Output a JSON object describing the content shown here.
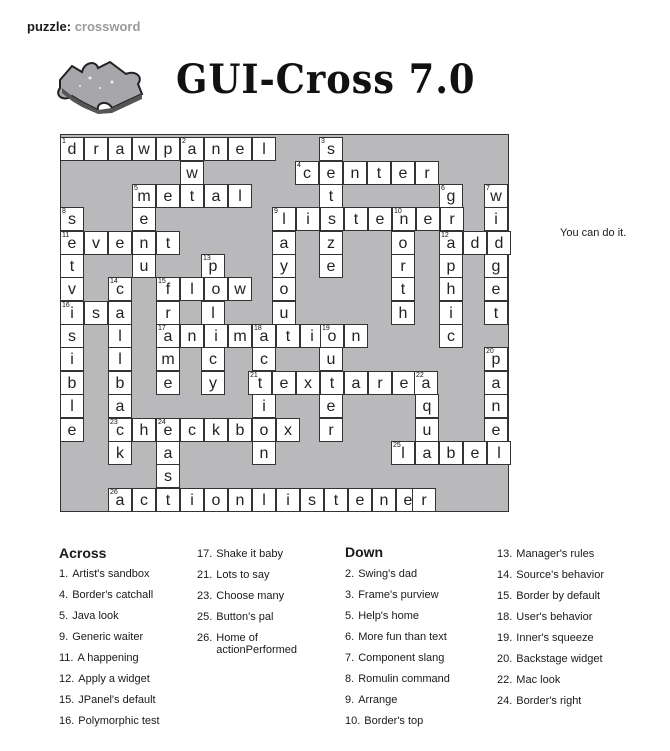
{
  "header": {
    "label": "puzzle:",
    "value": "crossword"
  },
  "title": "GUI-Cross 7.0",
  "note": "You can do it.",
  "grid": {
    "cells": [
      [
        "n0",
        60,
        137,
        "1",
        "d"
      ],
      [
        "n0",
        84,
        137,
        "",
        "r"
      ],
      [
        "n0",
        108,
        137,
        "",
        "a"
      ],
      [
        "n0",
        132,
        137,
        "",
        "w"
      ],
      [
        "n0",
        156,
        137,
        "",
        "p"
      ],
      [
        "n0",
        180,
        137,
        "2",
        "a"
      ],
      [
        "n0",
        204,
        137,
        "",
        "n"
      ],
      [
        "n0",
        228,
        137,
        "",
        "e"
      ],
      [
        "n0",
        252,
        137,
        "",
        "l"
      ],
      [
        "n0",
        319,
        137,
        "3",
        "s"
      ],
      [
        "n0",
        180,
        161,
        "",
        "w"
      ],
      [
        "n0",
        295,
        161,
        "4",
        "c"
      ],
      [
        "n0",
        319,
        161,
        "",
        "e"
      ],
      [
        "n0",
        343,
        161,
        "",
        "n"
      ],
      [
        "n0",
        367,
        161,
        "",
        "t"
      ],
      [
        "n0",
        391,
        161,
        "",
        "e"
      ],
      [
        "n0",
        415,
        161,
        "",
        "r"
      ],
      [
        "n0",
        132,
        184,
        "5",
        "m"
      ],
      [
        "n0",
        156,
        184,
        "",
        "e"
      ],
      [
        "n0",
        180,
        184,
        "",
        "t"
      ],
      [
        "n0",
        204,
        184,
        "",
        "a"
      ],
      [
        "n0",
        228,
        184,
        "",
        "l"
      ],
      [
        "n0",
        319,
        184,
        "",
        "t"
      ],
      [
        "n0",
        439,
        184,
        "6",
        "g"
      ],
      [
        "n0",
        484,
        184,
        "7",
        "w"
      ],
      [
        "n0",
        60,
        207,
        "8",
        "s"
      ],
      [
        "n0",
        132,
        207,
        "",
        "e"
      ],
      [
        "n0",
        272,
        207,
        "9",
        "l"
      ],
      [
        "n0",
        296,
        207,
        "",
        "i"
      ],
      [
        "n0",
        320,
        207,
        "",
        "s"
      ],
      [
        "n0",
        344,
        207,
        "",
        "t"
      ],
      [
        "n0",
        368,
        207,
        "",
        "e"
      ],
      [
        "n0",
        392,
        207,
        "10",
        "n"
      ],
      [
        "n0",
        416,
        207,
        "",
        "e"
      ],
      [
        "n0",
        440,
        207,
        "",
        "r"
      ],
      [
        "n0",
        484,
        207,
        "",
        "i"
      ],
      [
        "n0",
        60,
        231,
        "11",
        "e"
      ],
      [
        "n0",
        84,
        231,
        "",
        "v"
      ],
      [
        "n0",
        108,
        231,
        "",
        "e"
      ],
      [
        "n0",
        132,
        231,
        "",
        "n"
      ],
      [
        "n0",
        156,
        231,
        "",
        "t"
      ],
      [
        "n0",
        272,
        231,
        "",
        "a"
      ],
      [
        "n0",
        319,
        231,
        "",
        "z"
      ],
      [
        "n0",
        391,
        231,
        "",
        "o"
      ],
      [
        "n0",
        439,
        231,
        "12",
        "a"
      ],
      [
        "n0",
        463,
        231,
        "",
        "d"
      ],
      [
        "n0",
        487,
        231,
        "",
        "d"
      ],
      [
        "n0",
        60,
        254,
        "",
        "t"
      ],
      [
        "n0",
        132,
        254,
        "",
        "u"
      ],
      [
        "n0",
        201,
        254,
        "13",
        "p"
      ],
      [
        "n0",
        272,
        254,
        "",
        "y"
      ],
      [
        "n0",
        319,
        254,
        "",
        "e"
      ],
      [
        "n0",
        391,
        254,
        "",
        "r"
      ],
      [
        "n0",
        439,
        254,
        "",
        "p"
      ],
      [
        "n0",
        484,
        254,
        "",
        "g"
      ],
      [
        "n0",
        60,
        277,
        "",
        "v"
      ],
      [
        "n0",
        108,
        277,
        "14",
        "c"
      ],
      [
        "n0",
        156,
        277,
        "15",
        "f"
      ],
      [
        "n0",
        180,
        277,
        "",
        "l"
      ],
      [
        "n0",
        204,
        277,
        "",
        "o"
      ],
      [
        "n0",
        228,
        277,
        "",
        "w"
      ],
      [
        "n0",
        272,
        277,
        "",
        "o"
      ],
      [
        "n0",
        391,
        277,
        "",
        "t"
      ],
      [
        "n0",
        439,
        277,
        "",
        "h"
      ],
      [
        "n0",
        484,
        277,
        "",
        "e"
      ],
      [
        "n0",
        60,
        301,
        "16",
        "i"
      ],
      [
        "n0",
        84,
        301,
        "",
        "s"
      ],
      [
        "n0",
        108,
        301,
        "",
        "a"
      ],
      [
        "n0",
        156,
        301,
        "",
        "r"
      ],
      [
        "n0",
        201,
        301,
        "",
        "l"
      ],
      [
        "n0",
        272,
        301,
        "",
        "u"
      ],
      [
        "n0",
        391,
        301,
        "",
        "h"
      ],
      [
        "n0",
        439,
        301,
        "",
        "i"
      ],
      [
        "n0",
        484,
        301,
        "",
        "t"
      ],
      [
        "n0",
        60,
        324,
        "",
        "s"
      ],
      [
        "n0",
        108,
        324,
        "",
        "l"
      ],
      [
        "n0",
        156,
        324,
        "17",
        "a"
      ],
      [
        "n0",
        180,
        324,
        "",
        "n"
      ],
      [
        "n0",
        204,
        324,
        "",
        "i"
      ],
      [
        "n0",
        228,
        324,
        "",
        "m"
      ],
      [
        "n0",
        252,
        324,
        "18",
        "a"
      ],
      [
        "n0",
        276,
        324,
        "",
        "t"
      ],
      [
        "n0",
        300,
        324,
        "",
        "i"
      ],
      [
        "n0",
        320,
        324,
        "19",
        "o"
      ],
      [
        "n0",
        344,
        324,
        "",
        "n"
      ],
      [
        "n0",
        439,
        324,
        "",
        "c"
      ],
      [
        "n0",
        60,
        347,
        "",
        "i"
      ],
      [
        "n0",
        108,
        347,
        "",
        "l"
      ],
      [
        "n0",
        156,
        347,
        "",
        "m"
      ],
      [
        "n0",
        201,
        347,
        "",
        "c"
      ],
      [
        "n0",
        252,
        347,
        "",
        "c"
      ],
      [
        "n0",
        319,
        347,
        "",
        "u"
      ],
      [
        "n0",
        484,
        347,
        "20",
        "p"
      ],
      [
        "n0",
        60,
        371,
        "",
        "b"
      ],
      [
        "n0",
        108,
        371,
        "",
        "b"
      ],
      [
        "n0",
        156,
        371,
        "",
        "e"
      ],
      [
        "n0",
        201,
        371,
        "",
        "y"
      ],
      [
        "n0",
        248,
        371,
        "21",
        "t"
      ],
      [
        "n0",
        272,
        371,
        "",
        "e"
      ],
      [
        "n0",
        296,
        371,
        "",
        "x"
      ],
      [
        "n0",
        320,
        371,
        "",
        "t"
      ],
      [
        "n0",
        344,
        371,
        "",
        "a"
      ],
      [
        "n0",
        368,
        371,
        "",
        "r"
      ],
      [
        "n0",
        392,
        371,
        "",
        "e"
      ],
      [
        "n0",
        414,
        371,
        "22",
        "a"
      ],
      [
        "n0",
        484,
        371,
        "",
        "a"
      ],
      [
        "n0",
        60,
        394,
        "",
        "l"
      ],
      [
        "n0",
        108,
        394,
        "",
        "a"
      ],
      [
        "n0",
        252,
        394,
        "",
        "i"
      ],
      [
        "n0",
        319,
        394,
        "",
        "e"
      ],
      [
        "n0",
        415,
        394,
        "",
        "q"
      ],
      [
        "n0",
        484,
        394,
        "",
        "n"
      ],
      [
        "n0",
        60,
        418,
        "",
        "e"
      ],
      [
        "n0",
        108,
        418,
        "23",
        "c"
      ],
      [
        "n0",
        132,
        418,
        "",
        "h"
      ],
      [
        "n0",
        156,
        418,
        "24",
        "e"
      ],
      [
        "n0",
        180,
        418,
        "",
        "c"
      ],
      [
        "n0",
        204,
        418,
        "",
        "k"
      ],
      [
        "n0",
        228,
        418,
        "",
        "b"
      ],
      [
        "n0",
        252,
        418,
        "",
        "o"
      ],
      [
        "n0",
        276,
        418,
        "",
        "x"
      ],
      [
        "n0",
        319,
        418,
        "",
        "r"
      ],
      [
        "n0",
        415,
        418,
        "",
        "u"
      ],
      [
        "n0",
        484,
        418,
        "",
        "e"
      ],
      [
        "n0",
        108,
        441,
        "",
        "k"
      ],
      [
        "n0",
        156,
        441,
        "",
        "a"
      ],
      [
        "n0",
        252,
        441,
        "",
        "n"
      ],
      [
        "n0",
        391,
        441,
        "25",
        "l"
      ],
      [
        "n0",
        415,
        441,
        "",
        "a"
      ],
      [
        "n0",
        439,
        441,
        "",
        "b"
      ],
      [
        "n0",
        463,
        441,
        "",
        "e"
      ],
      [
        "n0",
        487,
        441,
        "",
        "l"
      ],
      [
        "n0",
        156,
        464,
        "",
        "s"
      ],
      [
        "n0",
        108,
        488,
        "26",
        "a"
      ],
      [
        "n0",
        132,
        488,
        "",
        "c"
      ],
      [
        "n0",
        156,
        488,
        "",
        "t"
      ],
      [
        "n0",
        180,
        488,
        "",
        "i"
      ],
      [
        "n0",
        204,
        488,
        "",
        "o"
      ],
      [
        "n0",
        228,
        488,
        "",
        "n"
      ],
      [
        "n0",
        252,
        488,
        "",
        "l"
      ],
      [
        "n0",
        276,
        488,
        "",
        "i"
      ],
      [
        "n0",
        300,
        488,
        "",
        "s"
      ],
      [
        "n0",
        324,
        488,
        "",
        "t"
      ],
      [
        "n0",
        348,
        488,
        "",
        "e"
      ],
      [
        "n0",
        372,
        488,
        "",
        "n"
      ],
      [
        "n0",
        396,
        488,
        "",
        "e"
      ],
      [
        "n0",
        412,
        488,
        "",
        "r"
      ]
    ]
  },
  "across": {
    "heading": "Across",
    "col1": [
      {
        "num": "1.",
        "text": "Artist's sandbox"
      },
      {
        "num": "4.",
        "text": "Border's catchall"
      },
      {
        "num": "5.",
        "text": "Java look"
      },
      {
        "num": "9.",
        "text": "Generic waiter"
      },
      {
        "num": "11.",
        "text": "A happening"
      },
      {
        "num": "12.",
        "text": "Apply a widget"
      },
      {
        "num": "15.",
        "text": "JPanel's default"
      },
      {
        "num": "16.",
        "text": "Polymorphic test"
      }
    ],
    "col2": [
      {
        "num": "17.",
        "text": "Shake it baby"
      },
      {
        "num": "21.",
        "text": "Lots to say"
      },
      {
        "num": "23.",
        "text": "Choose many"
      },
      {
        "num": "25.",
        "text": "Button's pal"
      },
      {
        "num": "26.",
        "text": "Home of actionPerformed"
      }
    ]
  },
  "down": {
    "heading": "Down",
    "col1": [
      {
        "num": "2.",
        "text": "Swing's dad"
      },
      {
        "num": "3.",
        "text": "Frame's purview"
      },
      {
        "num": "5.",
        "text": "Help's home"
      },
      {
        "num": "6.",
        "text": "More fun than text"
      },
      {
        "num": "7.",
        "text": "Component slang"
      },
      {
        "num": "8.",
        "text": "Romulin command"
      },
      {
        "num": "9.",
        "text": "Arrange"
      },
      {
        "num": "10.",
        "text": "Border's top"
      }
    ],
    "col2": [
      {
        "num": "13.",
        "text": "Manager's rules"
      },
      {
        "num": "14.",
        "text": "Source's behavior"
      },
      {
        "num": "15.",
        "text": "Border by default"
      },
      {
        "num": "18.",
        "text": "User's behavior"
      },
      {
        "num": "19.",
        "text": "Inner's squeeze"
      },
      {
        "num": "20.",
        "text": "Backstage widget"
      },
      {
        "num": "22.",
        "text": "Mac look"
      },
      {
        "num": "24.",
        "text": "Border's right"
      }
    ]
  }
}
